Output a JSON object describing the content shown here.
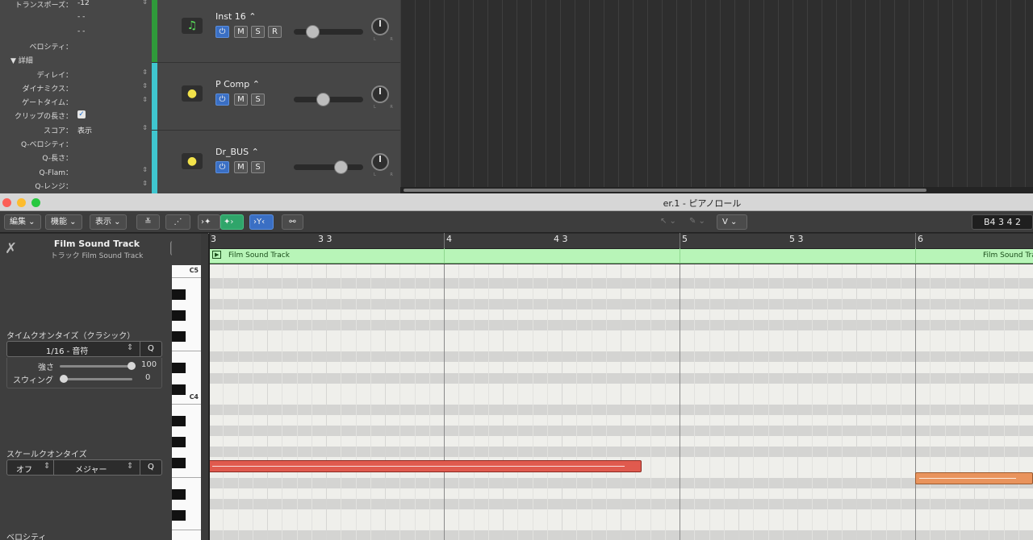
{
  "inspector": {
    "rows": [
      {
        "label": "トランスポーズ：",
        "value": "-12",
        "arrow": true
      },
      {
        "label": "",
        "value": "- -",
        "arrow": false
      },
      {
        "label": "",
        "value": "- -",
        "arrow": false
      },
      {
        "label": "ベロシティ：",
        "value": "",
        "arrow": false
      },
      {
        "section": "▼ 詳細"
      },
      {
        "label": "ディレイ：",
        "value": "",
        "arrow": true
      },
      {
        "label": "ダイナミクス：",
        "value": "",
        "arrow": true
      },
      {
        "label": "ゲートタイム：",
        "value": "",
        "arrow": true
      },
      {
        "label": "クリップの長さ：",
        "value": "",
        "check": true
      },
      {
        "label": "スコア：",
        "value": "表示",
        "arrow": true
      },
      {
        "label": "Q-ベロシティ：",
        "value": "",
        "arrow": false
      },
      {
        "label": "Q-長さ：",
        "value": "",
        "arrow": false
      },
      {
        "label": "Q-Flam：",
        "value": "",
        "arrow": true
      },
      {
        "label": "Q-レンジ：",
        "value": "",
        "arrow": true
      }
    ]
  },
  "tracks": [
    {
      "name": "Inst 16 ⌃",
      "color": "#2f9a3a",
      "icon": "♫",
      "icon_color": "#5be35b",
      "buttons": [
        "M",
        "S",
        "R"
      ],
      "fader": 0.22
    },
    {
      "name": "P Comp ⌃",
      "color": "#3fc6cf",
      "icon": "●",
      "icon_color": "#f2e24a",
      "buttons": [
        "M",
        "S"
      ],
      "fader": 0.4
    },
    {
      "name": "Dr_BUS ⌃",
      "color": "#3fc6cf",
      "icon": "●",
      "icon_color": "#f2e24a",
      "buttons": [
        "M",
        "S"
      ],
      "fader": 0.72
    }
  ],
  "pan_label": "L R",
  "window": {
    "title": "er.1 - ピアノロール"
  },
  "toolbar": {
    "edit": "編集 ⌄",
    "function": "機能 ⌄",
    "view": "表示 ⌄",
    "midi_in": "≚",
    "link": "⋰",
    "catch": "›✦",
    "midi_out": "✦›",
    "flex": "›Y‹",
    "chain": "⚯",
    "pointer": "↖ ⌄",
    "pencil": "✎ ⌄",
    "tool_v": "V ⌄",
    "position": "B4  3 4 2"
  },
  "piano_inspector": {
    "region_name": "Film Sound Track",
    "track_label": "トラック Film Sound Track",
    "time_quantize_label": "タイムクオンタイズ（クラシック）",
    "time_quantize_value": "1/16 - 音符",
    "q_button": "Q",
    "strength_label": "強さ",
    "strength_value": "100",
    "strength": 1.0,
    "swing_label": "スウィング",
    "swing_value": "0",
    "swing": 0.0,
    "scale_quantize_label": "スケールクオンタイズ",
    "scale_off": "オフ",
    "scale_type": "メジャー",
    "velocity_label": "ベロシティ"
  },
  "keyboard": {
    "labels": [
      "C5",
      "C4"
    ]
  },
  "ruler": {
    "marks": [
      "3",
      "3 3",
      "4",
      "4 3",
      "5",
      "5 3",
      "6"
    ]
  },
  "region": {
    "name": "Film Sound Track",
    "color": "#b8f5b8"
  },
  "notes": [
    {
      "bar_start": 3.0,
      "bar_end": 4.84,
      "pitch": "F3",
      "color": "#e05a4e"
    },
    {
      "bar_start": 6.0,
      "bar_end": 6.5,
      "pitch": "E3",
      "color": "#e9935c"
    }
  ]
}
